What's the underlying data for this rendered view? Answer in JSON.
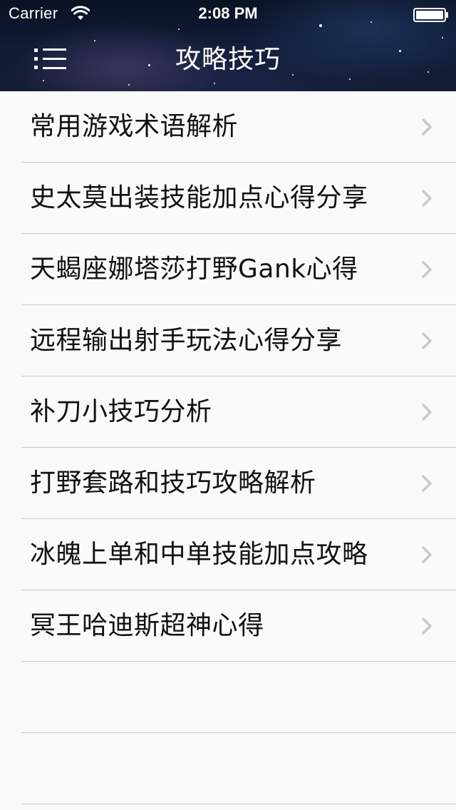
{
  "status_bar": {
    "carrier": "Carrier",
    "time": "2:08 PM",
    "wifi_icon": "wifi-icon",
    "battery_icon": "battery-icon"
  },
  "nav": {
    "title": "攻略技巧",
    "menu_icon": "list-menu-icon"
  },
  "list": {
    "items": [
      {
        "label": "常用游戏术语解析"
      },
      {
        "label": "史太莫出装技能加点心得分享"
      },
      {
        "label": "天蝎座娜塔莎打野Gank心得"
      },
      {
        "label": "远程输出射手玩法心得分享"
      },
      {
        "label": "补刀小技巧分析"
      },
      {
        "label": "打野套路和技巧攻略解析"
      },
      {
        "label": "冰魄上单和中单技能加点攻略"
      },
      {
        "label": "冥王哈迪斯超神心得"
      }
    ],
    "chevron_icon": "chevron-right-icon"
  },
  "colors": {
    "header_bg": "#0f1c36",
    "list_bg": "#fbfafb",
    "separator": "#c9c9cd",
    "chevron": "#c7c7cc",
    "text": "#111111"
  }
}
